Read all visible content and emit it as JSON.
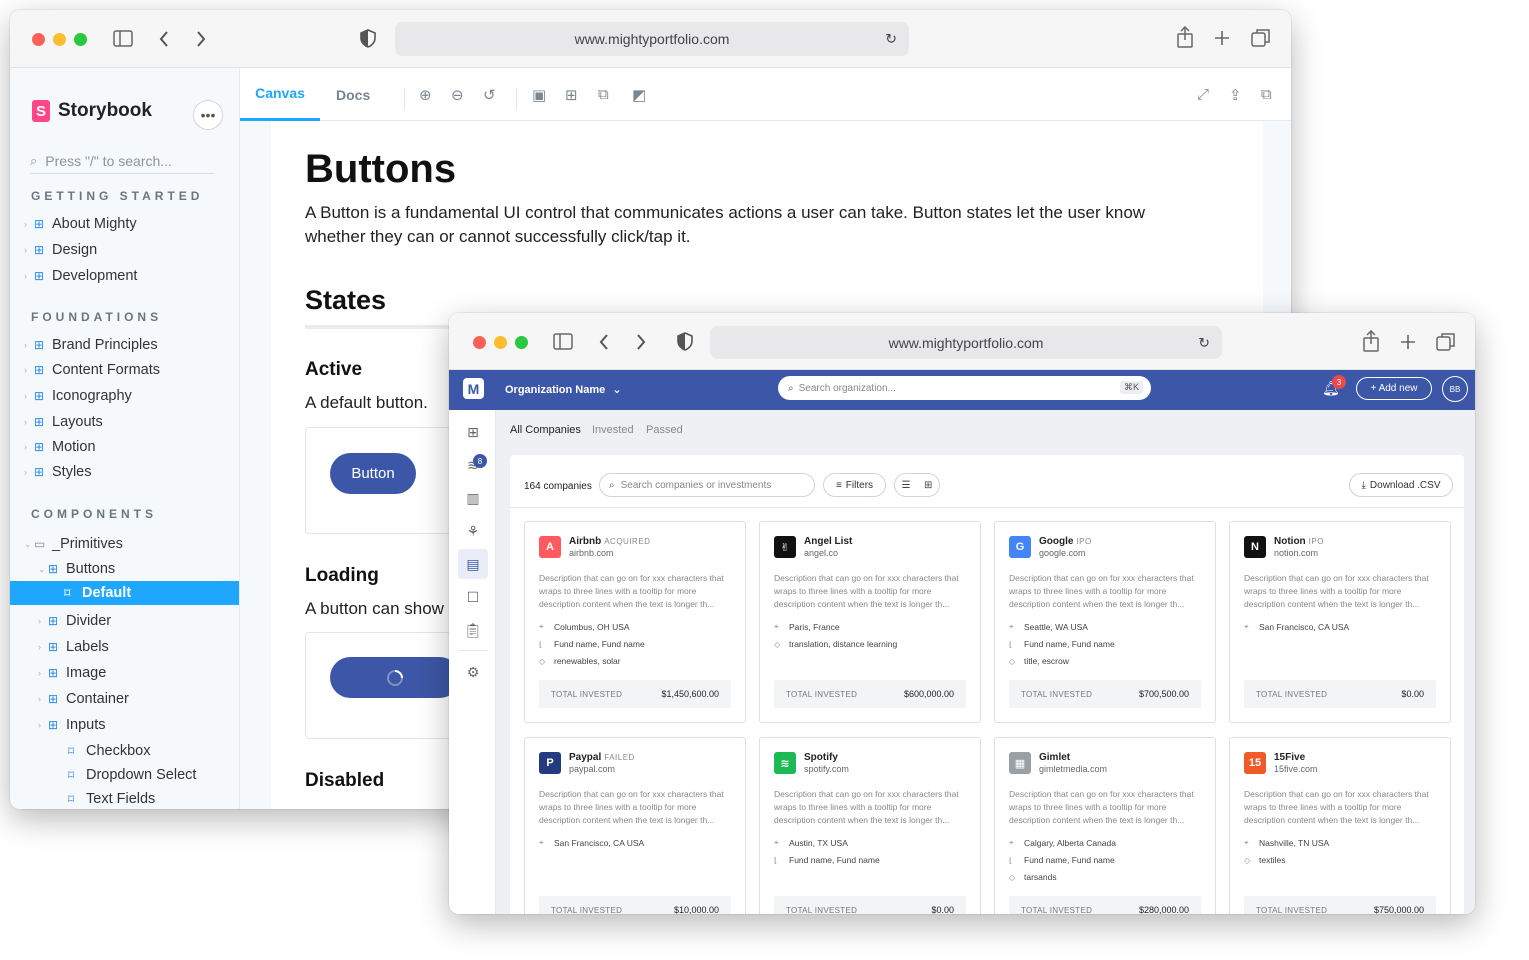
{
  "storybook_window": {
    "url": "www.mightyportfolio.com",
    "app_name": "Storybook",
    "more_label": "•••",
    "search_placeholder": "Press \"/\" to search...",
    "sections": [
      {
        "title": "GETTING STARTED",
        "items": [
          "About Mighty",
          "Design",
          "Development"
        ]
      },
      {
        "title": "FOUNDATIONS",
        "items": [
          "Brand Principles",
          "Content Formats",
          "Iconography",
          "Layouts",
          "Motion",
          "Styles"
        ]
      },
      {
        "title": "COMPONENTS"
      }
    ],
    "tree": {
      "primitives": "_Primitives",
      "buttons": "Buttons",
      "default": "Default",
      "others": [
        "Divider",
        "Labels",
        "Image",
        "Container",
        "Inputs"
      ],
      "input_children": [
        "Checkbox",
        "Dropdown Select",
        "Text Fields"
      ]
    },
    "tabs": [
      "Canvas",
      "Docs"
    ],
    "doc": {
      "title": "Buttons",
      "intro": "A Button is a fundamental UI control that communicates actions a user can take. Button states let the user know whether they can or cannot successfully click/tap it.",
      "states_heading": "States",
      "active_heading": "Active",
      "active_text": "A default button.",
      "button_label": "Button",
      "loading_heading": "Loading",
      "loading_text": "A button can show",
      "disabled_heading": "Disabled"
    }
  },
  "portfolio_window": {
    "url": "www.mightyportfolio.com",
    "logo_letter": "M",
    "org_name": "Organization  Name",
    "search_placeholder": "Search organization...",
    "search_shortcut": "⌘K",
    "notification_count": "3",
    "add_new_label": "+ Add new",
    "avatar_initials": "BB",
    "rail_badge": "8",
    "tabs": [
      "All Companies",
      "Invested",
      "Passed"
    ],
    "company_count": "164 companies",
    "company_search_placeholder": "Search companies or investments",
    "filters_label": "Filters",
    "download_label": "Download .CSV",
    "total_label": "TOTAL INVESTED",
    "description": "Description that can go on for xxx characters that wraps to three lines with a tooltip for more description content when the text is longer th...",
    "companies": [
      {
        "name": "Airbnb",
        "status": "ACQUIRED",
        "domain": "airbnb.com",
        "logo_text": "A",
        "logo_color": "#ff5a5f",
        "location": "Columbus, OH USA",
        "funds": "Fund name, Fund name",
        "tags": "renewables, solar",
        "total": "$1,450,600.00"
      },
      {
        "name": "Angel List",
        "status": "",
        "domain": "angel.co",
        "logo_text": "✌",
        "logo_color": "#111111",
        "location": "Paris, France",
        "funds": "",
        "tags": "translation, distance learning",
        "total": "$600,000.00"
      },
      {
        "name": "Google",
        "status": "IPO",
        "domain": "google.com",
        "logo_text": "G",
        "logo_color": "#4285f4",
        "location": "Seattle, WA USA",
        "funds": "Fund name, Fund name",
        "tags": "title, escrow",
        "total": "$700,500.00"
      },
      {
        "name": "Notion",
        "status": "IPO",
        "domain": "notion.com",
        "logo_text": "N",
        "logo_color": "#111111",
        "location": "San Francisco, CA USA",
        "funds": "",
        "tags": "",
        "total": "$0.00"
      },
      {
        "name": "Paypal",
        "status": "FAILED",
        "domain": "paypal.com",
        "logo_text": "P",
        "logo_color": "#253b80",
        "location": "San Francisco, CA USA",
        "funds": "",
        "tags": "",
        "total": "$10,000.00"
      },
      {
        "name": "Spotify",
        "status": "",
        "domain": "spotify.com",
        "logo_text": "≋",
        "logo_color": "#1db954",
        "location": "Austin, TX USA",
        "funds": "Fund name, Fund name",
        "tags": "",
        "total": "$0.00"
      },
      {
        "name": "Gimlet",
        "status": "",
        "domain": "gimletmedia.com",
        "logo_text": "▦",
        "logo_color": "#9aa0a6",
        "location": "Calgary, Alberta Canada",
        "funds": "Fund name, Fund name",
        "tags": "tarsands",
        "total": "$280,000.00"
      },
      {
        "name": "15Five",
        "status": "",
        "domain": "15five.com",
        "logo_text": "15",
        "logo_color": "#f05a28",
        "location": "Nashville, TN USA",
        "funds": "",
        "tags": "textiles",
        "total": "$750,000.00"
      }
    ]
  }
}
